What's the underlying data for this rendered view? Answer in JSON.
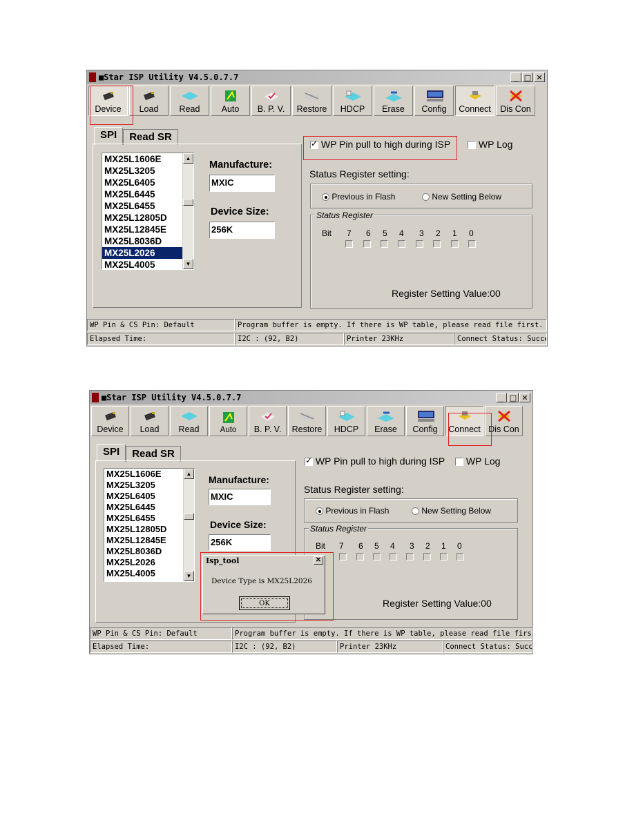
{
  "window": {
    "title": "■Star ISP Utility V4.5.0.7.7",
    "controls": [
      "_",
      "□",
      "✕"
    ]
  },
  "toolbar": [
    "Device",
    "Load",
    "Read",
    "Auto",
    "B. P. V.",
    "Restore",
    "HDCP",
    "Erase",
    "Config",
    "Connect",
    "Dis Con"
  ],
  "tabs": [
    "SPI",
    "Read SR"
  ],
  "device_list": [
    "MX25L1606E",
    "MX25L3205",
    "MX25L6405",
    "MX25L6445",
    "MX25L6455",
    "MX25L12805D",
    "MX25L12845E",
    "MX25L8036D",
    "MX25L2026",
    "MX25L4005"
  ],
  "selected_device": "MX25L2026",
  "manufacture_label": "Manufacture:",
  "manufacture_value": "MXIC",
  "size_label": "Device Size:",
  "size_value": "256K",
  "wp_pin_label": "WP Pin pull to high during ISP",
  "wp_log_label": "WP Log",
  "status_reg_setting_label": "Status Register setting:",
  "radio_previous": "Previous in Flash",
  "radio_new": "New Setting Below",
  "status_register_group": "Status Register",
  "bit_label": "Bit",
  "bits": [
    "7",
    "6",
    "5",
    "4",
    "3",
    "2",
    "1",
    "0"
  ],
  "register_value": "Register Setting Value:00",
  "statusbar": {
    "wp_cs": "WP Pin & CS Pin: Default",
    "program_buffer": "Program buffer is empty. If there is WP table, please read file first.",
    "elapsed": "Elapsed Time:",
    "i2c": "I2C : (92, B2)",
    "printer": "Printer  23KHz",
    "connect_status": "Connect Status: Success"
  },
  "dialog": {
    "title": "Isp_tool",
    "message": "Device Type is MX25L2026",
    "ok": "OK"
  },
  "colors": {
    "highlight_box": "#e02020",
    "selection": "#0a246a",
    "face": "#d4d0c8"
  }
}
